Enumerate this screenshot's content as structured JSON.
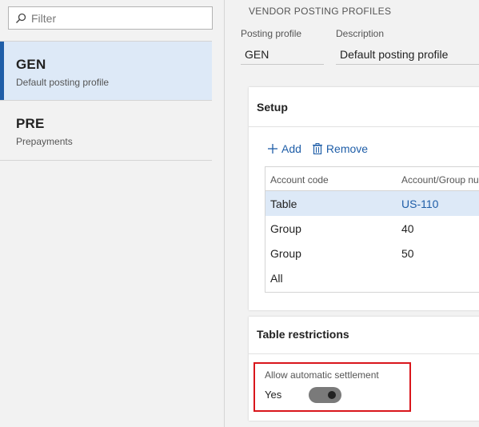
{
  "filter": {
    "placeholder": "Filter"
  },
  "profiles": [
    {
      "code": "GEN",
      "description": "Default posting profile",
      "selected": true
    },
    {
      "code": "PRE",
      "description": "Prepayments",
      "selected": false
    }
  ],
  "page": {
    "section_title": "VENDOR POSTING PROFILES",
    "posting_profile_label": "Posting profile",
    "posting_profile_value": "GEN",
    "description_label": "Description",
    "description_value": "Default posting profile"
  },
  "setup": {
    "title": "Setup",
    "add_label": "Add",
    "remove_label": "Remove",
    "columns": [
      "Account code",
      "Account/Group nu"
    ],
    "rows": [
      {
        "account_code": "Table",
        "account_group": "US-110",
        "selected": true
      },
      {
        "account_code": "Group",
        "account_group": "40",
        "selected": false
      },
      {
        "account_code": "Group",
        "account_group": "50",
        "selected": false
      },
      {
        "account_code": "All",
        "account_group": "",
        "selected": false
      }
    ]
  },
  "restrictions": {
    "title": "Table restrictions",
    "auto_settlement_label": "Allow automatic settlement",
    "auto_settlement_value": "Yes",
    "auto_settlement_on": true
  },
  "colors": {
    "accent": "#1f5ea8",
    "selected_bg": "#dde9f7",
    "highlight_border": "#d9161c"
  }
}
